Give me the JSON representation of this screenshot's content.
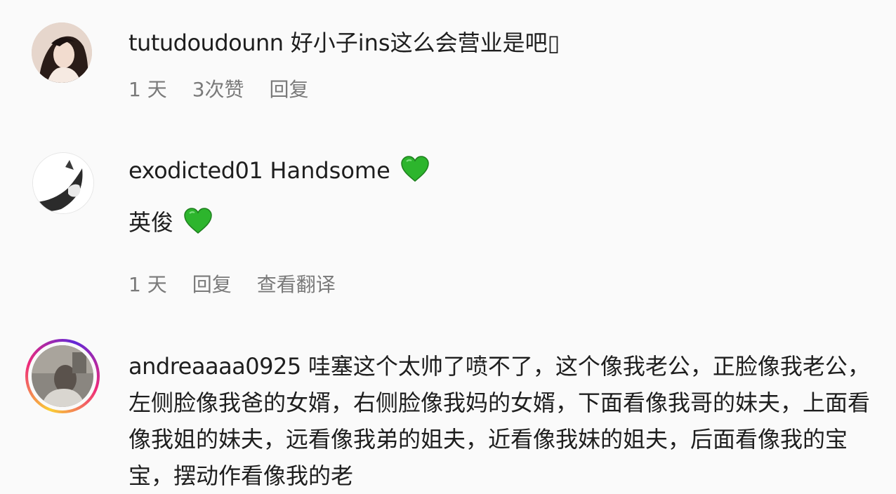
{
  "comments": [
    {
      "username": "tutudoudounn",
      "text": "好小子ins这么会营业是吧",
      "trailing_glyph": "▯",
      "time": "1 天",
      "likes": "3次赞",
      "reply": "回复"
    },
    {
      "username": "exodicted01",
      "text": "Handsome",
      "heart_icon": "green-heart-icon",
      "translation": "英俊",
      "time": "1 天",
      "reply": "回复",
      "see_translation": "查看翻译"
    },
    {
      "username": "andreaaaa0925",
      "text": "哇塞这个太帅了喷不了，这个像我老公，正脸像我老公，左侧脸像我爸的女婿，右侧脸像我妈的女婿，下面看像我哥的妹夫，上面看像我姐的妹夫，远看像我弟的姐夫，近看像我妹的姐夫，后面看像我的宝宝，摆动作看像我的老",
      "story_ring": true
    }
  ],
  "colors": {
    "heart": "#2db52d",
    "meta_text": "#7a7a7a",
    "story_ring_start": "#f9ce34",
    "story_ring_mid": "#ee2a7b",
    "story_ring_end": "#6228d7"
  }
}
